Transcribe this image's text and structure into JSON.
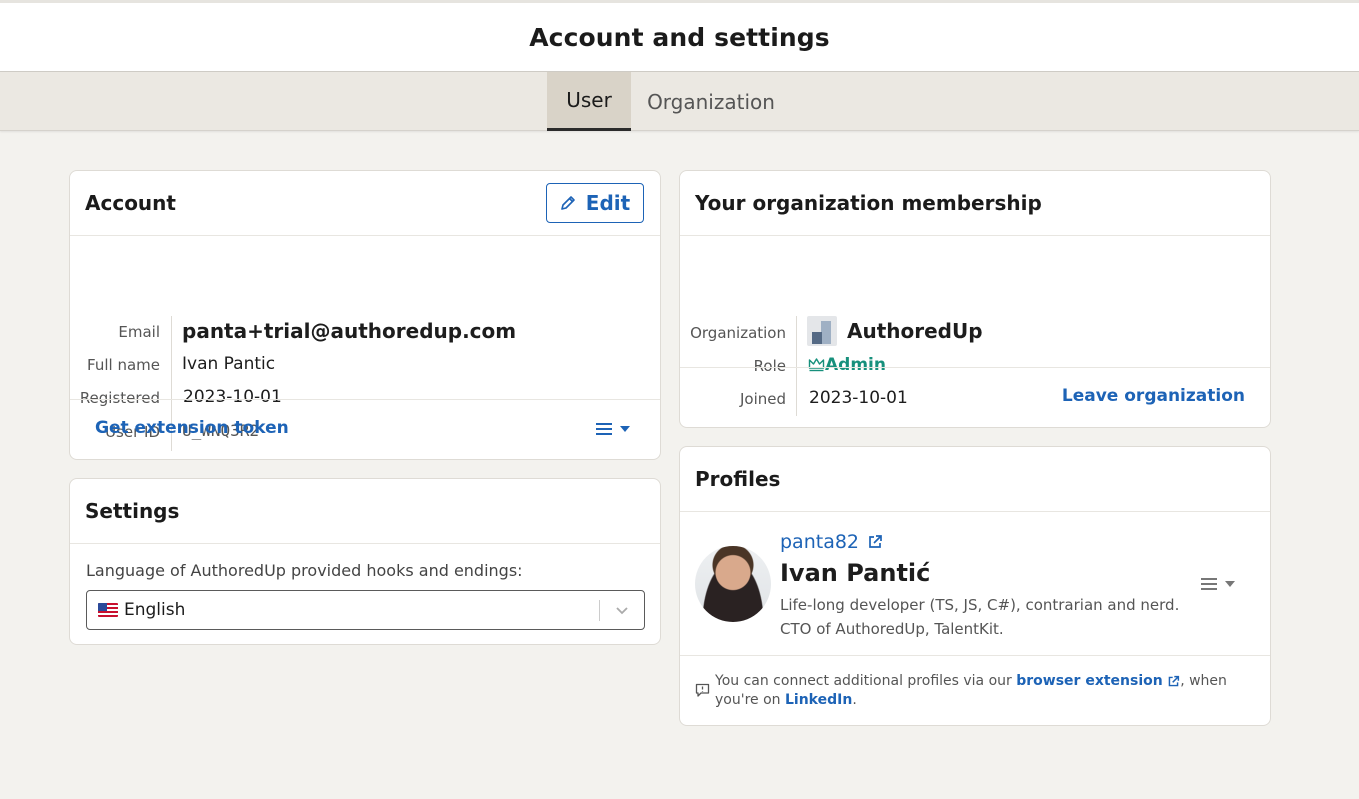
{
  "header": {
    "title": "Account and settings"
  },
  "tabs": [
    {
      "label": "User",
      "active": true
    },
    {
      "label": "Organization",
      "active": false
    }
  ],
  "account": {
    "title": "Account",
    "edit_label": "Edit",
    "fields": [
      {
        "label": "Email",
        "value": "panta+trial@authoredup.com"
      },
      {
        "label": "Full name",
        "value": "Ivan Pantic"
      },
      {
        "label": "Registered",
        "value": "2023-10-01"
      },
      {
        "label": "User ID",
        "value": "U_WNQ3R2"
      }
    ],
    "extension_token_label": "Get extension token"
  },
  "settings": {
    "title": "Settings",
    "language_label": "Language of AuthoredUp provided hooks and endings:",
    "language_value": "English",
    "language_flag": "us-flag-icon"
  },
  "organization": {
    "title": "Your organization membership",
    "fields": [
      {
        "label": "Organization",
        "value": "AuthoredUp"
      },
      {
        "label": "Role",
        "value": "Admin"
      },
      {
        "label": "Joined",
        "value": "2023-10-01"
      }
    ],
    "leave_label": "Leave organization"
  },
  "profiles": {
    "title": "Profiles",
    "items": [
      {
        "handle": "panta82",
        "name": "Ivan Pantić",
        "bio_line1": "Life-long developer (TS, JS, C#), contrarian and nerd.",
        "bio_line2": "CTO of AuthoredUp, TalentKit."
      }
    ],
    "note_prefix": "You can connect additional profiles via our",
    "note_link1": "browser extension",
    "note_middle": ", when",
    "note_line2_prefix": "you're on",
    "note_link2": "LinkedIn",
    "note_suffix": "."
  },
  "colors": {
    "link": "#1d63b6",
    "admin": "#17907c",
    "background": "#f3f2ee"
  }
}
